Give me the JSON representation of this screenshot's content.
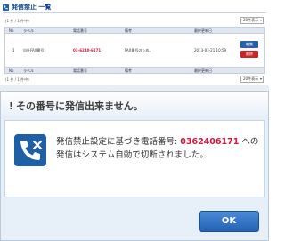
{
  "page": {
    "title": "発信禁止 一覧",
    "range_text": "(1 件 / 1 件中)",
    "per_page": "20件表示",
    "columns": [
      "No",
      "ラベル",
      "電話番号",
      "備考",
      "最終更新日"
    ],
    "rows": [
      {
        "no": "1",
        "label": "自社FAX番号",
        "phone": "03-6240-6171",
        "note": "FAX番号のため。",
        "updated": "2013-03-21 10:59"
      }
    ],
    "edit_label": "編集",
    "delete_label": "削除"
  },
  "dialog": {
    "title_bang": "!",
    "title": "その番号に発信出来ません。",
    "message_before": "発信禁止設定に基づき電話番号: ",
    "message_number": "0362406171",
    "message_after": " への発信はシステム自動で切断されました。",
    "ok_label": "OK"
  },
  "colors": {
    "accent": "#1e5fa6",
    "number": "#d0143a",
    "edit": "#2d5fa8",
    "delete": "#c62828"
  }
}
